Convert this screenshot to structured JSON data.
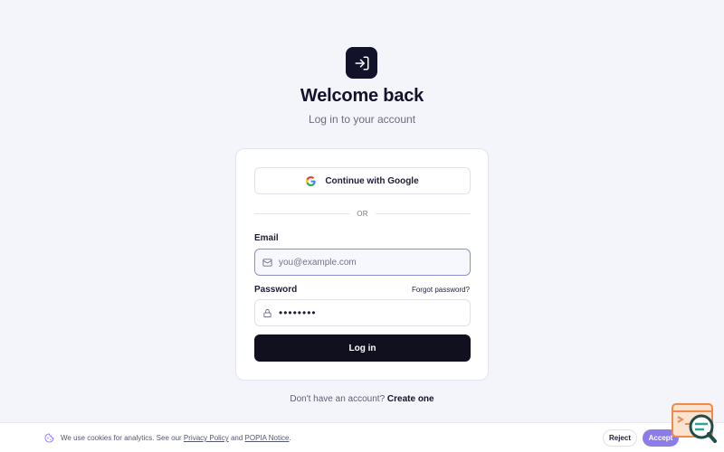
{
  "header": {
    "title": "Welcome back",
    "subtitle": "Log in to your account"
  },
  "card": {
    "google_label": "Continue with Google",
    "divider_text": "OR",
    "email": {
      "label": "Email",
      "placeholder": "you@example.com",
      "value": ""
    },
    "password": {
      "label": "Password",
      "forgot_label": "Forgot password?",
      "value": "••••••••"
    },
    "login_label": "Log in"
  },
  "signup": {
    "prompt": "Don't have an account?",
    "link": "Create one"
  },
  "cookie": {
    "text_before": "We use cookies for analytics. See our ",
    "privacy_link": "Privacy Policy",
    "text_and": " and ",
    "popia_link": "POPIA Notice",
    "text_after": ".",
    "reject_label": "Reject",
    "accept_label": "Accept"
  },
  "icons": {
    "logo": "login-arrow-icon",
    "google": "google-icon",
    "email": "mail-icon",
    "password": "lock-icon",
    "cookie": "cookie-icon",
    "widget": "chat-search-widget-icon"
  },
  "colors": {
    "background": "#f4f5fa",
    "primary": "#10101f",
    "accent": "#8b7ce8",
    "focus_border": "#8a8fd0"
  }
}
